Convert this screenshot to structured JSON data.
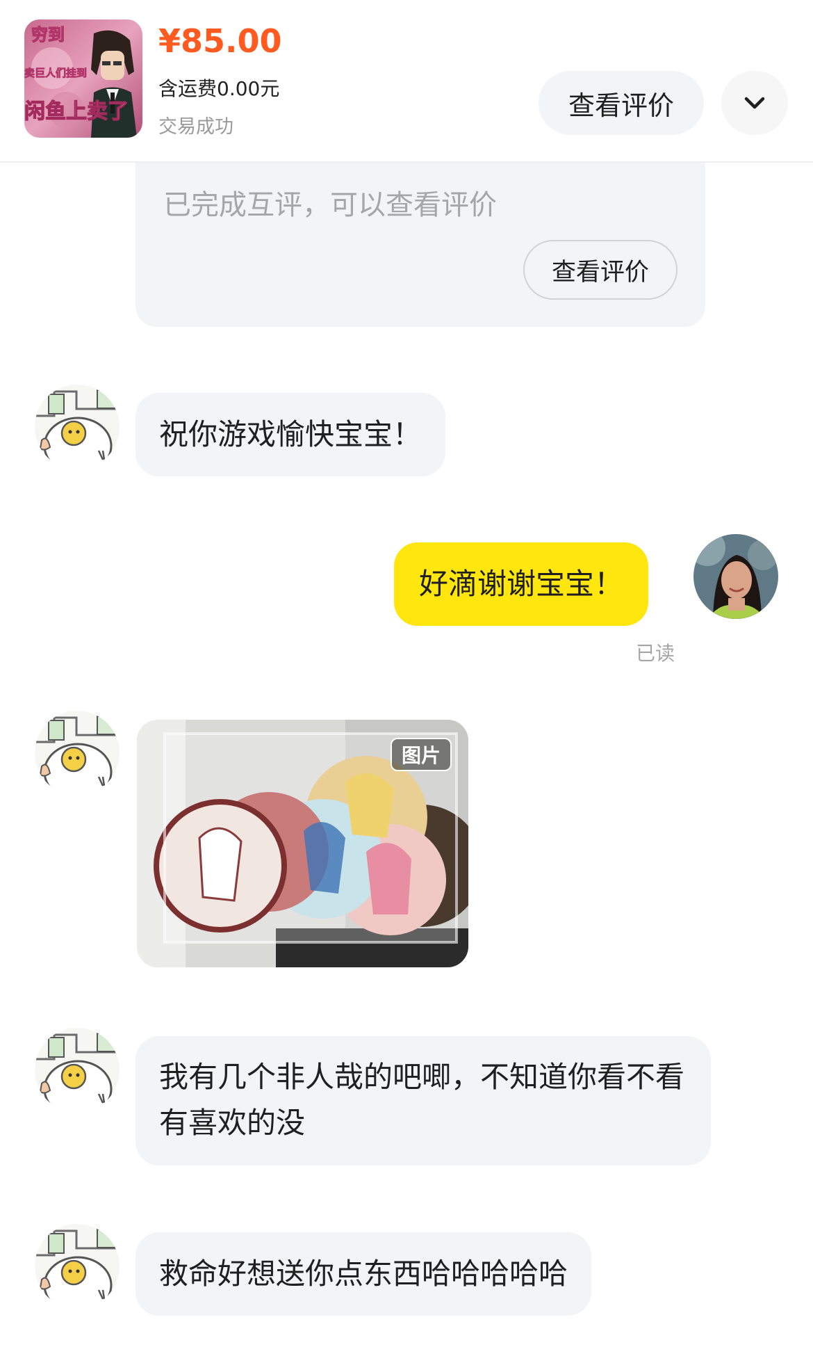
{
  "order": {
    "price": "¥85.00",
    "shipping": "含运费0.00元",
    "status": "交易成功",
    "review_button": "查看评价",
    "thumbnail_text": [
      "穷到",
      "卖巨人们挂到",
      "闲鱼上卖了"
    ]
  },
  "system_card": {
    "text": "已完成互评，可以查看评价",
    "button": "查看评价"
  },
  "messages": [
    {
      "sender": "seller",
      "text": "祝你游戏愉快宝宝！"
    },
    {
      "sender": "me",
      "text": "好滴谢谢宝宝！",
      "status": "已读"
    },
    {
      "sender": "seller",
      "type": "image",
      "tag": "图片"
    },
    {
      "sender": "seller",
      "text": "我有几个非人哉的吧唧，不知道你看不看有喜欢的没"
    },
    {
      "sender": "seller",
      "text": "救命好想送你点东西哈哈哈哈哈"
    }
  ],
  "icons": {
    "expand": "chevron-down-icon"
  },
  "colors": {
    "price": "#ff5a1f",
    "out_bubble": "#ffe60f",
    "in_bubble": "#f3f4f6"
  }
}
